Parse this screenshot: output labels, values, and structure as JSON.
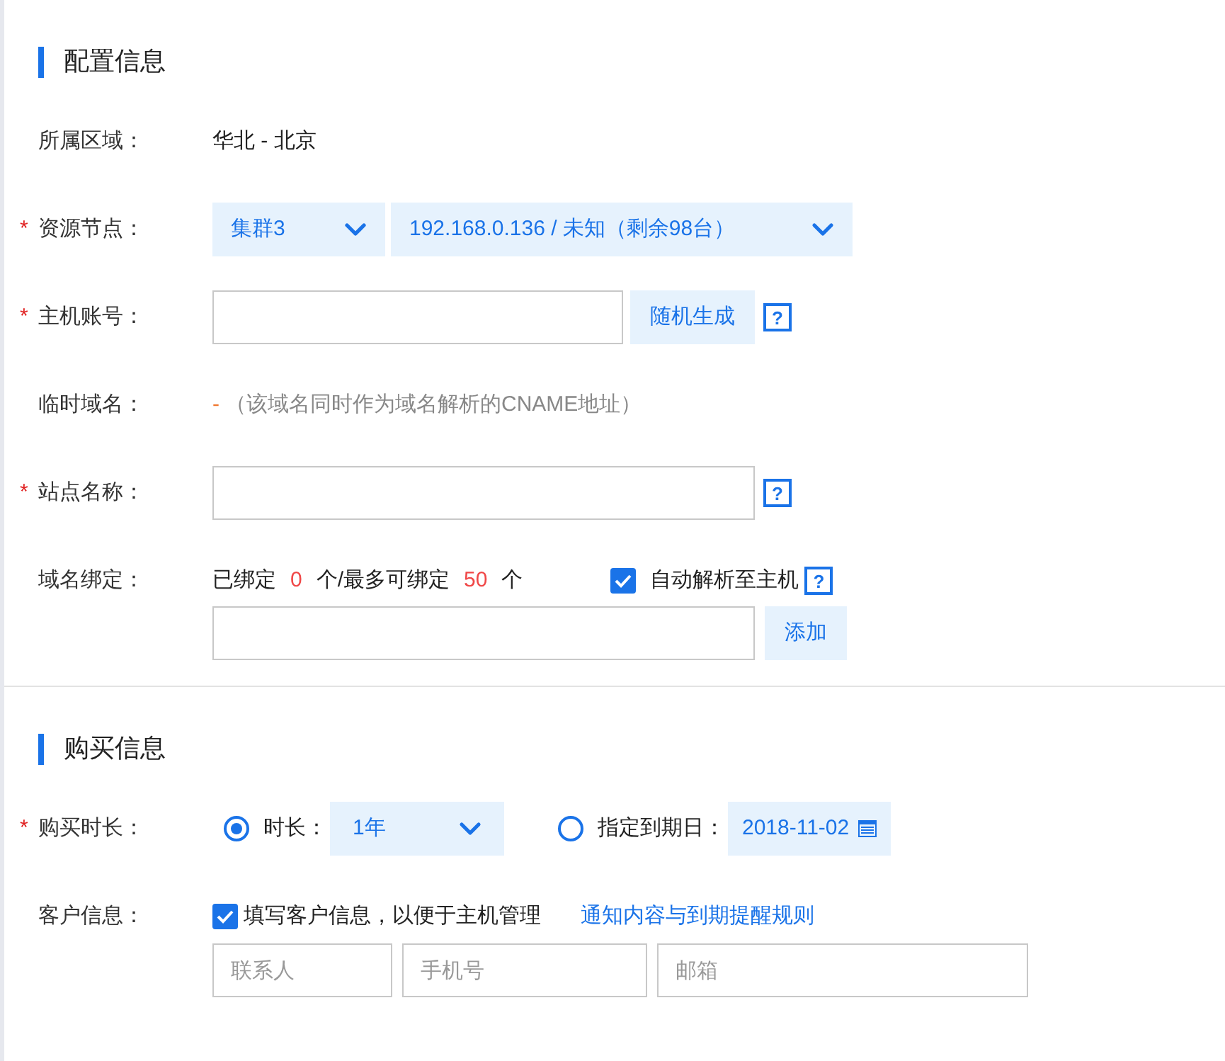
{
  "sections": [
    {
      "title": "配置信息",
      "rows": [
        {
          "kind": "text",
          "label": "所属区域：",
          "value": "华北 - 北京"
        },
        {
          "kind": "selects",
          "label": "资源节点：",
          "required_mark": "*",
          "selects": [
            {
              "value": "集群3"
            },
            {
              "value": "192.168.0.136 / 未知（剩余98台）"
            }
          ]
        },
        {
          "kind": "input_button",
          "label": "主机账号：",
          "required_mark": "*",
          "button": "随机生成",
          "help": "?"
        },
        {
          "kind": "note",
          "label": "临时域名：",
          "dash": "-",
          "note": "（该域名同时作为域名解析的CNAME地址）"
        },
        {
          "kind": "input_help",
          "label": "站点名称：",
          "required_mark": "*",
          "help": "?"
        },
        {
          "kind": "domain",
          "label": "域名绑定：",
          "bound_prefix": "已绑定",
          "bound": "0",
          "bound_mid": "个/最多可绑定",
          "max": "50",
          "unit": "个",
          "auto_resolve": {
            "label": "自动解析至主机",
            "checked": true
          },
          "help": "?",
          "button": "添加"
        }
      ]
    },
    {
      "title": "购买信息",
      "rows": [
        {
          "kind": "duration",
          "label": "购买时长：",
          "required_mark": "*",
          "options": [
            {
              "label": "时长：",
              "selected": true,
              "select": "1年"
            },
            {
              "label": "指定到期日：",
              "selected": false,
              "date": "2018-11-02"
            }
          ]
        },
        {
          "kind": "customer",
          "label": "客户信息：",
          "checkbox": {
            "label": "填写客户信息，以便于主机管理",
            "checked": true
          },
          "link": "通知内容与到期提醒规则",
          "fields": [
            {
              "placeholder": "联系人"
            },
            {
              "placeholder": "手机号"
            },
            {
              "placeholder": "邮箱"
            }
          ]
        }
      ]
    }
  ]
}
